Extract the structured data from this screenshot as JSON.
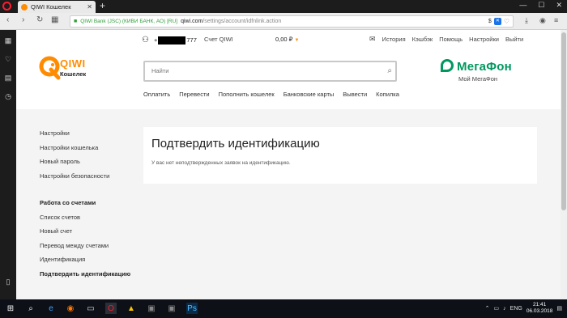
{
  "browser": {
    "tab_title": "QIWI Кошелек",
    "ssl_label": "QIWI Bank (JSC) (КИВИ БАНК, АО) [RU]",
    "url_domain": "qiwi.com",
    "url_path": "/settings/account/idfnlink.action"
  },
  "header": {
    "phone_suffix": "777",
    "account_label": "Счет QIWI",
    "balance": "0,00 ₽",
    "nav": [
      "История",
      "Кэшбэк",
      "Помощь",
      "Настройки",
      "Выйти"
    ]
  },
  "logo": {
    "word": "QIWI",
    "sub": "Кошелек"
  },
  "search": {
    "placeholder": "Найти"
  },
  "megafon": {
    "name": "МегаФон",
    "sub": "Мой МегаФон"
  },
  "mainnav": [
    "Оплатить",
    "Перевести",
    "Пополнить кошелек",
    "Банковские карты",
    "Вывести",
    "Копилка"
  ],
  "leftmenu": {
    "group1": [
      "Настройки",
      "Настройки кошелька",
      "Новый пароль",
      "Настройки безопасности"
    ],
    "group2_head": "Работа со счетами",
    "group2": [
      "Список счетов",
      "Новый счет",
      "Перевод между счетами",
      "Идентификация",
      "Подтвердить идентификацию"
    ]
  },
  "content": {
    "title": "Подтвердить идентификацию",
    "text": "У вас нет неподтвержденных заявок на идентификацию."
  },
  "taskbar": {
    "lang": "ENG",
    "time": "21:41",
    "date": "06.03.2018"
  },
  "colors": {
    "qiwi_orange": "#ff8c00",
    "megafon_green": "#00985f"
  }
}
